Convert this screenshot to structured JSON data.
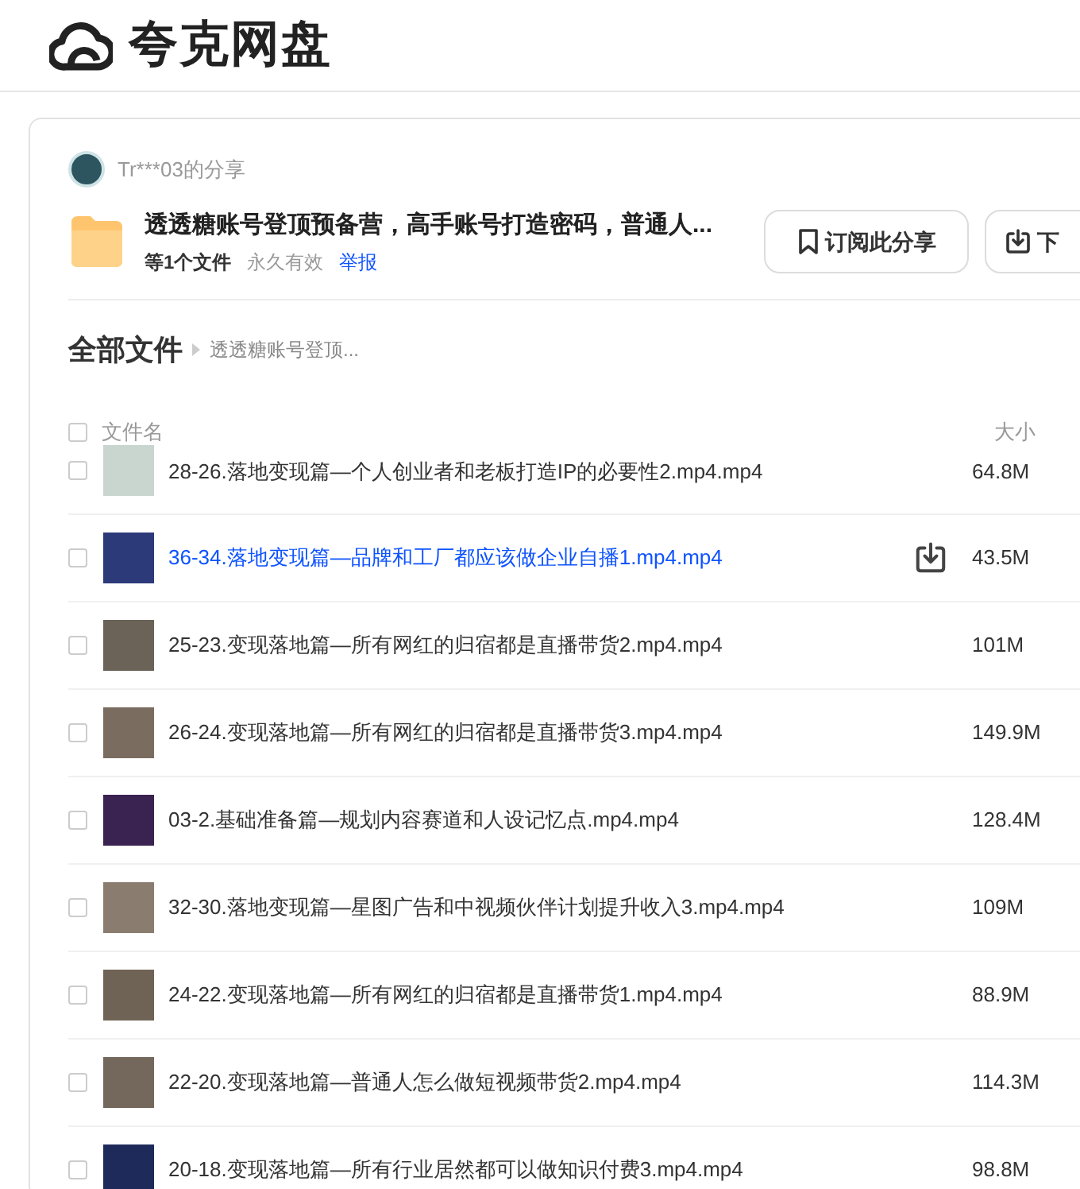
{
  "header": {
    "logo_text": "夸克网盘"
  },
  "share": {
    "owner": "Tr***03的分享",
    "title": "透透糖账号登顶预备营，高手账号打造密码，普通人...",
    "file_count": "等1个文件",
    "validity": "永久有效",
    "report_link": "举报",
    "buttons": [
      {
        "kind": "subscribe",
        "label": "订阅此分享"
      },
      {
        "kind": "download",
        "label": "下"
      }
    ]
  },
  "breadcrumb": {
    "root": "全部文件",
    "current": "透透糖账号登顶..."
  },
  "table": {
    "select_all_checked": false,
    "columns": [
      "文件名",
      "大小"
    ],
    "rows": [
      {
        "name": "28-26.落地变现篇—个人创业者和老板打造IP的必要性2.mp4.mp4",
        "size": "64.8M",
        "hovered": false,
        "checked": false
      },
      {
        "name": "36-34.落地变现篇—品牌和工厂都应该做企业自播1.mp4.mp4",
        "size": "43.5M",
        "hovered": true,
        "checked": false
      },
      {
        "name": "25-23.变现落地篇—所有网红的归宿都是直播带货2.mp4.mp4",
        "size": "101M",
        "hovered": false,
        "checked": false
      },
      {
        "name": "26-24.变现落地篇—所有网红的归宿都是直播带货3.mp4.mp4",
        "size": "149.9M",
        "hovered": false,
        "checked": false
      },
      {
        "name": "03-2.基础准备篇—规划内容赛道和人设记忆点.mp4.mp4",
        "size": "128.4M",
        "hovered": false,
        "checked": false
      },
      {
        "name": "32-30.落地变现篇—星图广告和中视频伙伴计划提升收入3.mp4.mp4",
        "size": "109M",
        "hovered": false,
        "checked": false
      },
      {
        "name": "24-22.变现落地篇—所有网红的归宿都是直播带货1.mp4.mp4",
        "size": "88.9M",
        "hovered": false,
        "checked": false
      },
      {
        "name": "22-20.变现落地篇—普通人怎么做短视频带货2.mp4.mp4",
        "size": "114.3M",
        "hovered": false,
        "checked": false
      },
      {
        "name": "20-18.变现落地篇—所有行业居然都可以做知识付费3.mp4.mp4",
        "size": "98.8M",
        "hovered": false,
        "checked": false
      }
    ]
  }
}
